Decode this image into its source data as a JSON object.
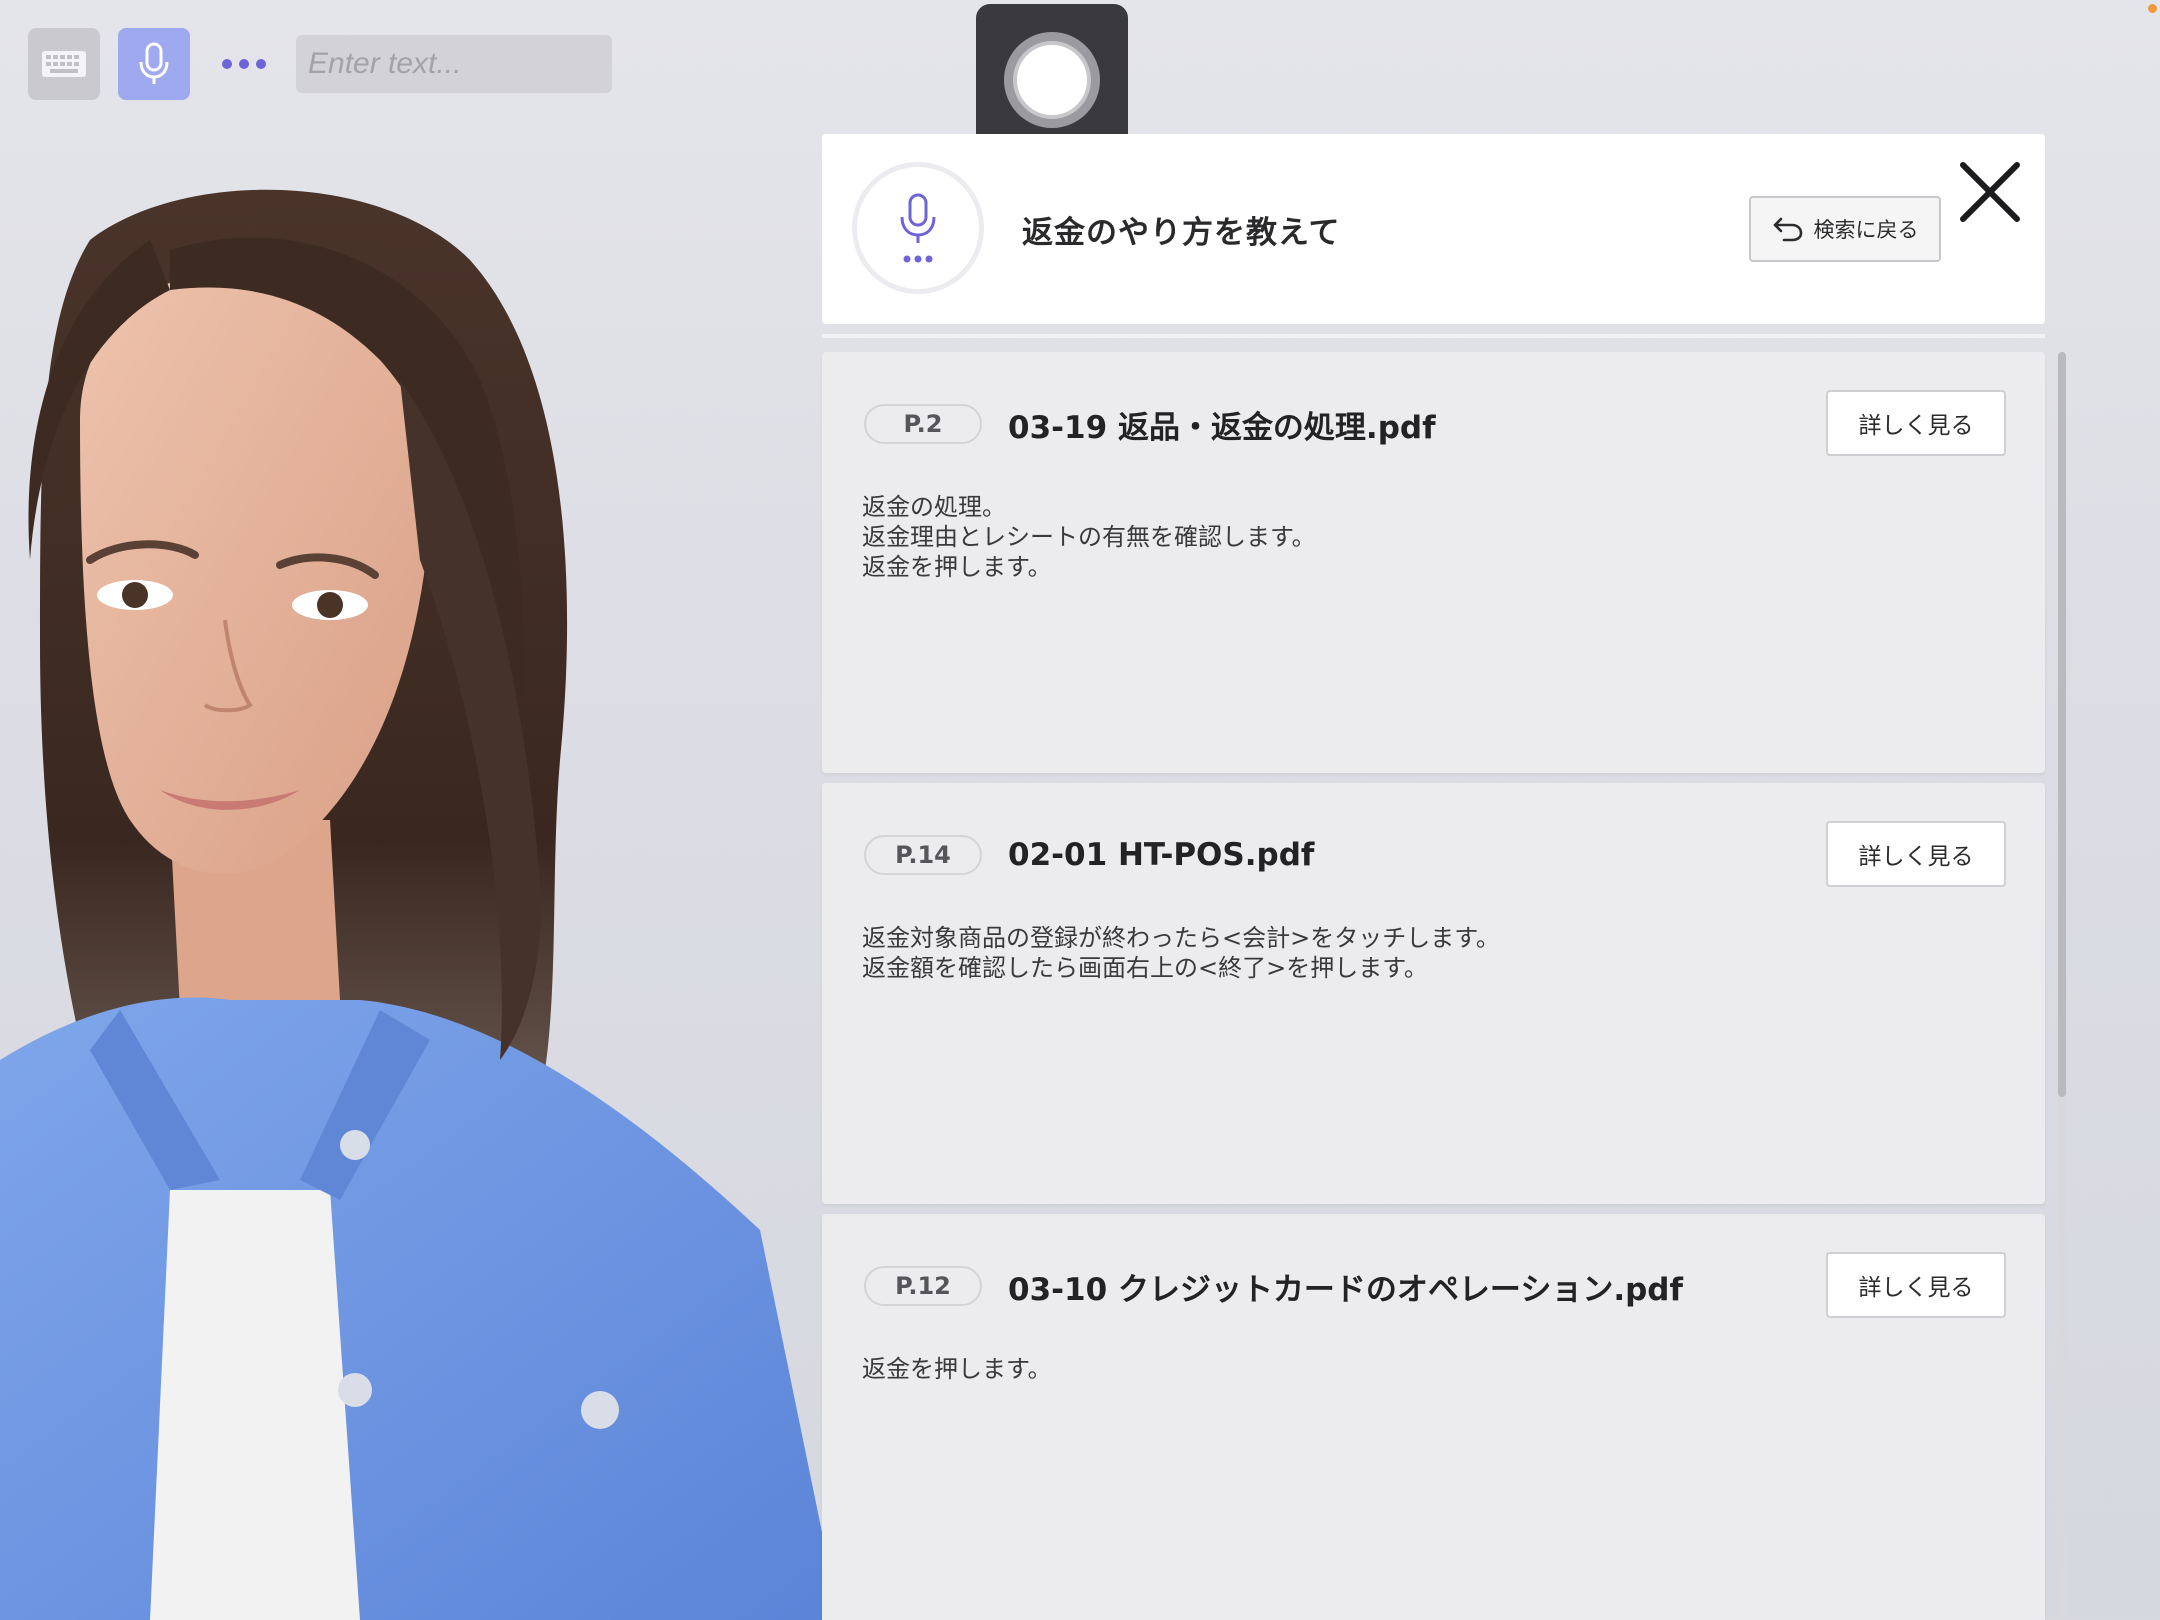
{
  "toolbar": {
    "keyboard_icon": "keyboard-icon",
    "mic_icon": "microphone-icon",
    "more_icon": "more-dots-icon",
    "input_placeholder": "Enter text..."
  },
  "record": {
    "icon": "record-button-icon"
  },
  "query": {
    "text": "返金のやり方を教えて",
    "back_label": "検索に戻る",
    "close_icon": "close-icon"
  },
  "results": [
    {
      "page": "P.2",
      "title": "03-19 返品・返金の処理.pdf",
      "button": "詳しく見る",
      "lines": [
        "返金の処理。",
        "返金理由とレシートの有無を確認します。",
        "返金を押します。"
      ]
    },
    {
      "page": "P.14",
      "title": "02-01 HT-POS.pdf",
      "button": "詳しく見る",
      "lines": [
        "返金対象商品の登録が終わったら<会計>をタッチします。",
        "返金額を確認したら画面右上の<終了>を押します。"
      ]
    },
    {
      "page": "P.12",
      "title": "03-10 クレジットカードのオペレーション.pdf",
      "button": "詳しく見る",
      "lines": [
        "返金を押します。"
      ]
    }
  ],
  "colors": {
    "accent": "#6f63d8",
    "mic_button_bg": "#9fa9ef",
    "shirt": "#6f98e3",
    "hair": "#3b2a22",
    "status_dot": "#f29a3a"
  }
}
